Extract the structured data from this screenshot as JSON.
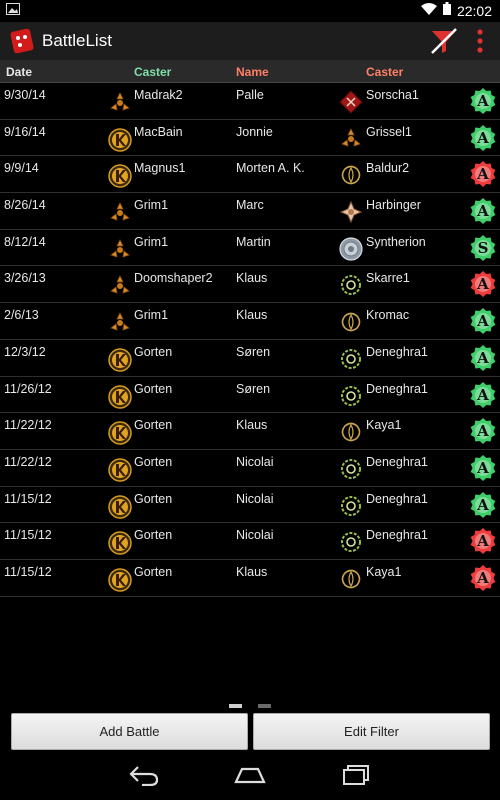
{
  "status": {
    "time": "22:02"
  },
  "app": {
    "title": "BattleList"
  },
  "header": {
    "date": "Date",
    "caster1": "Caster",
    "name": "Name",
    "caster2": "Caster"
  },
  "rows": [
    {
      "date": "9/30/14",
      "caster1": "Madrak2",
      "f1": "trollblood",
      "name": "Palle",
      "caster2": "Sorscha1",
      "f2": "khador",
      "result": "A",
      "win": true
    },
    {
      "date": "9/16/14",
      "caster1": "MacBain",
      "f1": "mercenary",
      "name": "Jonnie",
      "caster2": "Grissel1",
      "f2": "trollblood",
      "result": "A",
      "win": true
    },
    {
      "date": "9/9/14",
      "caster1": "Magnus1",
      "f1": "mercenary",
      "name": "Morten A. K.",
      "caster2": "Baldur2",
      "f2": "circle",
      "result": "A",
      "win": false
    },
    {
      "date": "8/26/14",
      "caster1": "Grim1",
      "f1": "trollblood",
      "name": "Marc",
      "caster2": "Harbinger",
      "f2": "menoth",
      "result": "A",
      "win": true
    },
    {
      "date": "8/12/14",
      "caster1": "Grim1",
      "f1": "trollblood",
      "name": "Martin",
      "caster2": "Syntherion",
      "f2": "convergence",
      "result": "S",
      "win": true
    },
    {
      "date": "3/26/13",
      "caster1": "Doomshaper2",
      "f1": "trollblood",
      "name": "Klaus",
      "caster2": "Skarre1",
      "f2": "cryx",
      "result": "A",
      "win": false
    },
    {
      "date": "2/6/13",
      "caster1": "Grim1",
      "f1": "trollblood",
      "name": "Klaus",
      "caster2": "Kromac",
      "f2": "circle",
      "result": "A",
      "win": true
    },
    {
      "date": "12/3/12",
      "caster1": "Gorten",
      "f1": "mercenary",
      "name": "Søren",
      "caster2": "Deneghra1",
      "f2": "cryx",
      "result": "A",
      "win": true
    },
    {
      "date": "11/26/12",
      "caster1": "Gorten",
      "f1": "mercenary",
      "name": "Søren",
      "caster2": "Deneghra1",
      "f2": "cryx",
      "result": "A",
      "win": true
    },
    {
      "date": "11/22/12",
      "caster1": "Gorten",
      "f1": "mercenary",
      "name": "Klaus",
      "caster2": "Kaya1",
      "f2": "circle",
      "result": "A",
      "win": true
    },
    {
      "date": "11/22/12",
      "caster1": "Gorten",
      "f1": "mercenary",
      "name": "Nicolai",
      "caster2": "Deneghra1",
      "f2": "cryx",
      "result": "A",
      "win": true
    },
    {
      "date": "11/15/12",
      "caster1": "Gorten",
      "f1": "mercenary",
      "name": "Nicolai",
      "caster2": "Deneghra1",
      "f2": "cryx",
      "result": "A",
      "win": true
    },
    {
      "date": "11/15/12",
      "caster1": "Gorten",
      "f1": "mercenary",
      "name": "Nicolai",
      "caster2": "Deneghra1",
      "f2": "cryx",
      "result": "A",
      "win": false
    },
    {
      "date": "11/15/12",
      "caster1": "Gorten",
      "f1": "mercenary",
      "name": "Klaus",
      "caster2": "Kaya1",
      "f2": "circle",
      "result": "A",
      "win": false
    }
  ],
  "buttons": {
    "add": "Add Battle",
    "filter": "Edit Filter"
  },
  "colors": {
    "win": "#3ecf6a",
    "loss": "#ee3b3b",
    "caster_header": "#7fe0a8",
    "name_header": "#ff7f66"
  },
  "pager": {
    "pages": 2,
    "current": 1
  }
}
